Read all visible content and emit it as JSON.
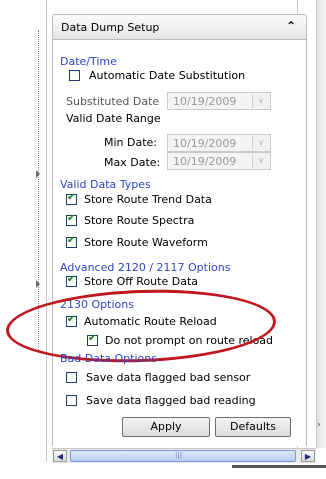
{
  "panel": {
    "title": "Data Dump Setup",
    "collapse_icon": "double-chevron-up-icon"
  },
  "date_time": {
    "heading": "Date/Time",
    "auto_date_label": "Automatic Date Substitution",
    "auto_date_checked": false,
    "substituted_date_label": "Substituted Date",
    "substituted_date_value": "10/19/2009",
    "valid_range_label": "Valid Date Range",
    "min_label": "Min Date:",
    "min_value": "10/19/2009",
    "max_label": "Max Date:",
    "max_value": "10/19/2009"
  },
  "valid_types": {
    "heading": "Valid Data Types",
    "items": [
      {
        "label": "Store Route Trend Data",
        "checked": true
      },
      {
        "label": "Store Route Spectra",
        "checked": true
      },
      {
        "label": "Store Route Waveform",
        "checked": true
      }
    ]
  },
  "advanced": {
    "heading": "Advanced 2120 / 2117 Options",
    "store_off_route_label": "Store Off Route Data",
    "store_off_route_checked": true
  },
  "opt2130": {
    "heading": "2130 Options",
    "auto_reload_label": "Automatic Route Reload",
    "auto_reload_checked": true,
    "no_prompt_label": "Do not prompt on route reload",
    "no_prompt_checked": true
  },
  "bad_data": {
    "heading": "Bad Data Options",
    "sensor_label": "Save data flagged bad sensor",
    "sensor_checked": false,
    "reading_label": "Save data flagged bad reading",
    "reading_checked": false
  },
  "buttons": {
    "apply": "Apply",
    "defaults": "Defaults"
  },
  "colors": {
    "section_heading": "#2d47c3",
    "highlight_ellipse": "#c0171e",
    "check_mark": "#118811"
  }
}
